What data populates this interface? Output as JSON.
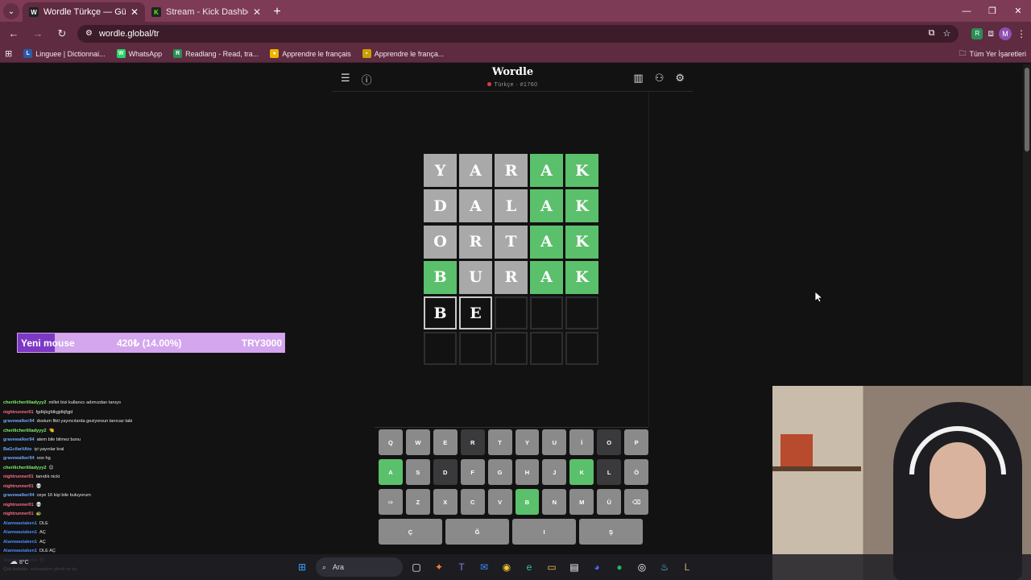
{
  "browser": {
    "tabs": [
      {
        "title": "Wordle Türkçe — Günlük kelim",
        "favicon": "W",
        "favicon_color": "#ffffff",
        "active": true
      },
      {
        "title": "Stream - Kick Dashboard",
        "favicon": "K",
        "favicon_color": "#53fc18",
        "active": false
      }
    ],
    "url": "wordle.global/tr",
    "bookmarks": [
      {
        "label": "Linguee | Dictionnai...",
        "icon": "L",
        "color": "#2b5aa8"
      },
      {
        "label": "WhatsApp",
        "icon": "W",
        "color": "#25d366"
      },
      {
        "label": "Readlang - Read, tra...",
        "icon": "R",
        "color": "#2a8f57"
      },
      {
        "label": "Apprendre le français",
        "icon": "●",
        "color": "#f0b400"
      },
      {
        "label": "Apprendre le frança...",
        "icon": "▪",
        "color": "#c9a200"
      }
    ],
    "all_bookmarks": "Tüm Yer İşaretleri",
    "profile_initial": "M"
  },
  "wordle": {
    "title": "Wordle",
    "subtitle": "Türkçe · #1760",
    "rows": [
      [
        {
          "l": "Y",
          "s": "gray"
        },
        {
          "l": "A",
          "s": "gray"
        },
        {
          "l": "R",
          "s": "gray"
        },
        {
          "l": "A",
          "s": "green"
        },
        {
          "l": "K",
          "s": "green"
        }
      ],
      [
        {
          "l": "D",
          "s": "gray"
        },
        {
          "l": "A",
          "s": "gray"
        },
        {
          "l": "L",
          "s": "gray"
        },
        {
          "l": "A",
          "s": "green"
        },
        {
          "l": "K",
          "s": "green"
        }
      ],
      [
        {
          "l": "O",
          "s": "gray"
        },
        {
          "l": "R",
          "s": "gray"
        },
        {
          "l": "T",
          "s": "gray"
        },
        {
          "l": "A",
          "s": "green"
        },
        {
          "l": "K",
          "s": "green"
        }
      ],
      [
        {
          "l": "B",
          "s": "green"
        },
        {
          "l": "U",
          "s": "gray"
        },
        {
          "l": "R",
          "s": "gray"
        },
        {
          "l": "A",
          "s": "green"
        },
        {
          "l": "K",
          "s": "green"
        }
      ],
      [
        {
          "l": "B",
          "s": "filled"
        },
        {
          "l": "E",
          "s": "filled"
        },
        {
          "l": "",
          "s": "empty"
        },
        {
          "l": "",
          "s": "empty"
        },
        {
          "l": "",
          "s": "empty"
        }
      ],
      [
        {
          "l": "",
          "s": "empty"
        },
        {
          "l": "",
          "s": "empty"
        },
        {
          "l": "",
          "s": "empty"
        },
        {
          "l": "",
          "s": "empty"
        },
        {
          "l": "",
          "s": "empty"
        }
      ]
    ],
    "keyboard": [
      [
        {
          "k": "Q"
        },
        {
          "k": "W"
        },
        {
          "k": "E"
        },
        {
          "k": "R",
          "s": "k-dark"
        },
        {
          "k": "T"
        },
        {
          "k": "Y"
        },
        {
          "k": "U"
        },
        {
          "k": "İ"
        },
        {
          "k": "O",
          "s": "k-dark"
        },
        {
          "k": "P"
        }
      ],
      [
        {
          "k": "A",
          "s": "k-green"
        },
        {
          "k": "S"
        },
        {
          "k": "D",
          "s": "k-dark"
        },
        {
          "k": "F"
        },
        {
          "k": "G"
        },
        {
          "k": "H"
        },
        {
          "k": "J"
        },
        {
          "k": "K",
          "s": "k-green"
        },
        {
          "k": "L",
          "s": "k-dark"
        },
        {
          "k": "Ö"
        }
      ],
      [
        {
          "k": "⇨"
        },
        {
          "k": "Z"
        },
        {
          "k": "X"
        },
        {
          "k": "C"
        },
        {
          "k": "V"
        },
        {
          "k": "B",
          "s": "k-green"
        },
        {
          "k": "N"
        },
        {
          "k": "M"
        },
        {
          "k": "Ü"
        },
        {
          "k": "⌫"
        }
      ],
      [
        {
          "k": "Ç",
          "s": "k-wide"
        },
        {
          "k": "Ğ",
          "s": "k-wide"
        },
        {
          "k": "I",
          "s": "k-wide"
        },
        {
          "k": "Ş",
          "s": "k-wide"
        }
      ]
    ]
  },
  "goal": {
    "label": "Yeni mouse",
    "progress": "420₺ (14.00%)",
    "progress_fraction": 0.14,
    "target": "TRY3000",
    "fill_color": "#7d39c4"
  },
  "chat": [
    {
      "user": "cherilicherililadyyy2",
      "color": "#7cf26b",
      "text": "millet bizi kullanıcı adımızdan tanıyo"
    },
    {
      "user": "nightrunner01",
      "color": "#ff6b8a",
      "text": "fgdkjkgfdkgjdkjfgjd"
    },
    {
      "user": "gravewalker94",
      "color": "#6ea8ff",
      "text": "dostum fikti yayıncılarda geziyorsun tanıcaz tabi"
    },
    {
      "user": "cherilicherililadyyy2",
      "color": "#7cf26b",
      "text": "🤏"
    },
    {
      "user": "gravewalker94",
      "color": "#6ea8ff",
      "text": "atem bile bilmez bunu"
    },
    {
      "user": "BaGcilarliAto",
      "color": "#6ea8ff",
      "text": "iyi yayınlar kral"
    },
    {
      "user": "gravewalker94",
      "color": "#6ea8ff",
      "text": "ooo hg"
    },
    {
      "user": "cherilicherililadyyy2",
      "color": "#7cf26b",
      "text": "😊"
    },
    {
      "user": "nightrunner01",
      "color": "#ff6b8a",
      "text": "tanıdık nicki"
    },
    {
      "user": "nightrunner01",
      "color": "#ff6b8a",
      "text": "💀"
    },
    {
      "user": "gravewalker94",
      "color": "#6ea8ff",
      "text": "ceye 16 kişi bile buluyorum"
    },
    {
      "user": "nightrunner01",
      "color": "#ff6b8a",
      "text": "💀"
    },
    {
      "user": "nightrunner01",
      "color": "#ff6b8a",
      "text": "🐢"
    },
    {
      "user": "Alamwastaken1",
      "color": "#4a8cff",
      "text": "DLE"
    },
    {
      "user": "Alamwastaken1",
      "color": "#4a8cff",
      "text": "AÇ"
    },
    {
      "user": "Alamwastaken1",
      "color": "#4a8cff",
      "text": "AÇ"
    },
    {
      "user": "Alamwastaken1",
      "color": "#4a8cff",
      "text": "DLE AÇ"
    },
    {
      "user": "Alamwastaken1",
      "color": "#4a8cff",
      "text": "😶"
    },
    {
      "user": "Çok bulutlu",
      "color": "#dddddd",
      "text": "anlamadım şimdi ne bu"
    }
  ],
  "taskbar": {
    "weather": "8°C",
    "search_placeholder": "Ara"
  }
}
